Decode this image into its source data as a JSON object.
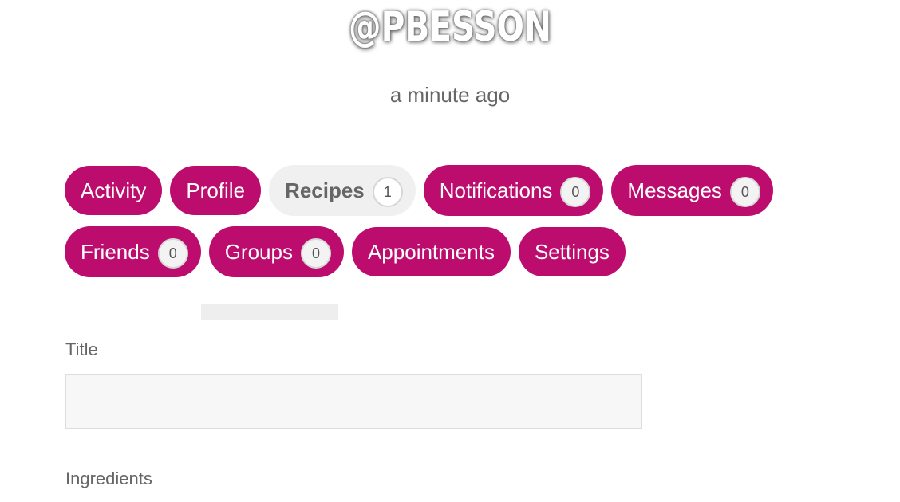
{
  "profile": {
    "username": "@PBESSON",
    "last_active": "a minute ago"
  },
  "tabs": [
    {
      "label": "Activity",
      "count": null,
      "active": false
    },
    {
      "label": "Profile",
      "count": null,
      "active": false
    },
    {
      "label": "Recipes",
      "count": "1",
      "active": true
    },
    {
      "label": "Notifications",
      "count": "0",
      "active": false
    },
    {
      "label": "Messages",
      "count": "0",
      "active": false
    },
    {
      "label": "Friends",
      "count": "0",
      "active": false
    },
    {
      "label": "Groups",
      "count": "0",
      "active": false
    },
    {
      "label": "Appointments",
      "count": null,
      "active": false
    },
    {
      "label": "Settings",
      "count": null,
      "active": false
    }
  ],
  "form": {
    "title_label": "Title",
    "title_value": "",
    "ingredients_label": "Ingredients"
  },
  "colors": {
    "accent": "#bc0d6f",
    "active_tab_bg": "#f0f0f0",
    "text": "#666666"
  }
}
